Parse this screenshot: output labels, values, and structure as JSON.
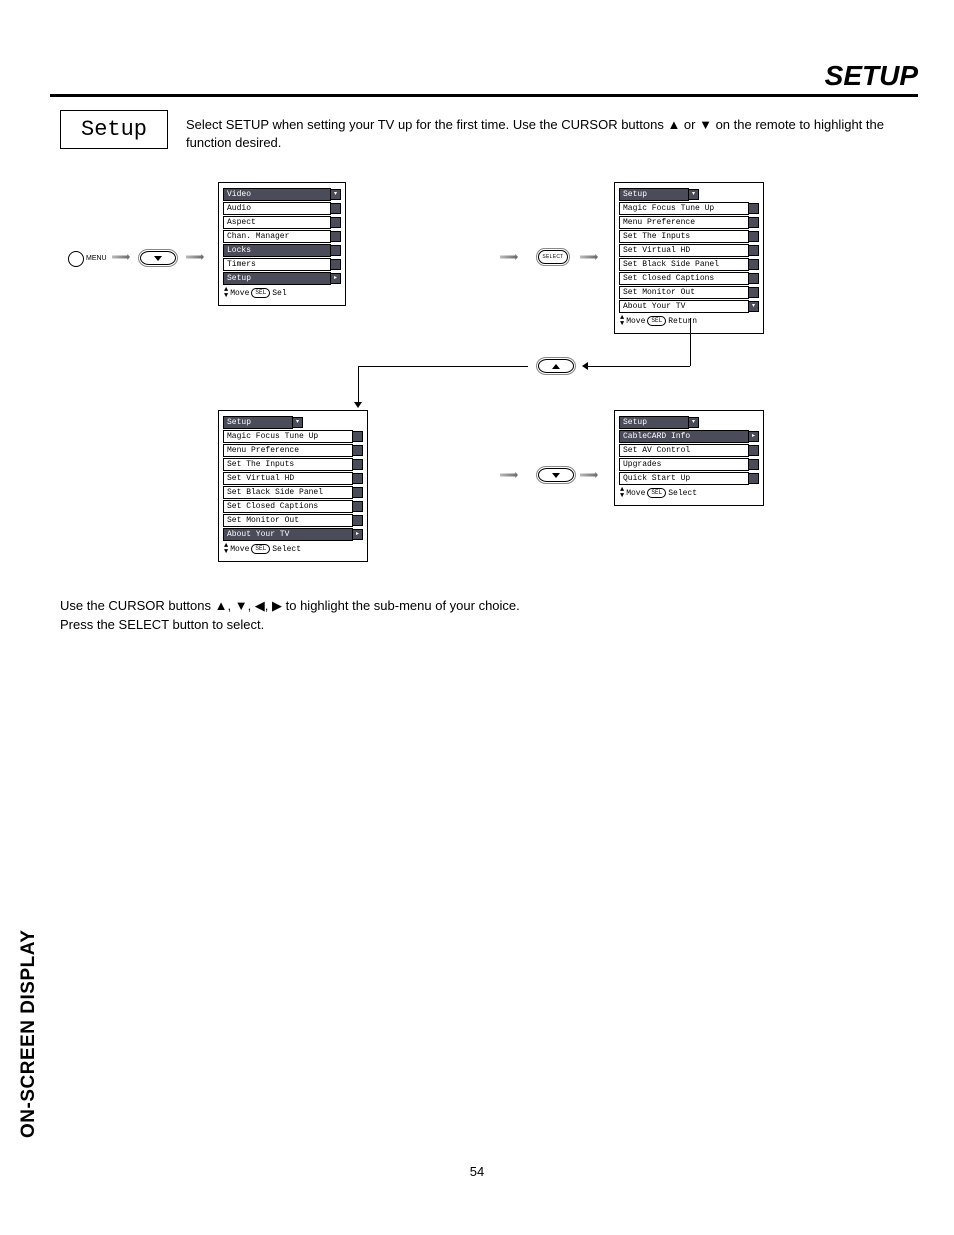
{
  "header": {
    "title": "SETUP"
  },
  "setup_label": "Setup",
  "intro": "Select SETUP when setting your TV up for the first time.  Use the CURSOR buttons ▲ or ▼ on the remote to highlight the function desired.",
  "menu_button_label": "MENU",
  "select_button_label": "SELECT",
  "osd1": {
    "title": "—",
    "items": [
      "Video",
      "Audio",
      "Aspect",
      "Chan. Manager",
      "Locks",
      "Timers",
      "Setup"
    ],
    "highlight_index": 6,
    "hint_move": "Move",
    "hint_sel_btn": "SEL",
    "hint_action": "Sel"
  },
  "osd2": {
    "title": "Setup",
    "items": [
      "Magic Focus Tune Up",
      "Menu Preference",
      "Set The Inputs",
      "Set Virtual HD",
      "Set Black Side Panel",
      "Set Closed Captions",
      "Set Monitor Out",
      "About Your TV"
    ],
    "highlight_index": -1,
    "hint_move": "Move",
    "hint_sel_btn": "SEL",
    "hint_action": "Return"
  },
  "osd3": {
    "title": "Setup",
    "items": [
      "Magic Focus Tune Up",
      "Menu Preference",
      "Set The Inputs",
      "Set Virtual HD",
      "Set Black Side Panel",
      "Set Closed Captions",
      "Set Monitor Out",
      "About Your TV"
    ],
    "highlight_index": 7,
    "hint_move": "Move",
    "hint_sel_btn": "SEL",
    "hint_action": "Select"
  },
  "osd4": {
    "title": "Setup",
    "items": [
      "CableCARD Info",
      "Set AV Control",
      "Upgrades",
      "Quick Start Up"
    ],
    "highlight_index": 0,
    "hint_move": "Move",
    "hint_sel_btn": "SEL",
    "hint_action": "Select"
  },
  "footer": {
    "line1": "Use the CURSOR buttons ▲, ▼, ◀, ▶ to highlight the sub-menu of your choice.",
    "line2": "Press the SELECT button to select."
  },
  "side_label": "ON-SCREEN DISPLAY",
  "page_number": "54"
}
